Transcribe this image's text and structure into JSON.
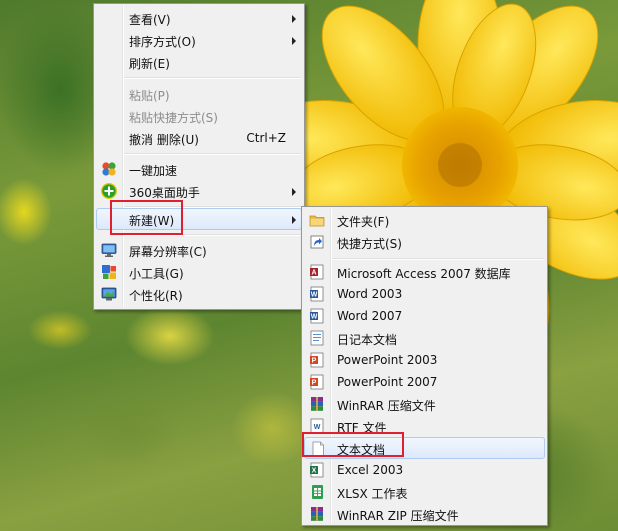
{
  "context_menu": {
    "items": [
      {
        "label": "查看(V)",
        "has_submenu": true,
        "enabled": true
      },
      {
        "label": "排序方式(O)",
        "has_submenu": true,
        "enabled": true
      },
      {
        "label": "刷新(E)",
        "has_submenu": false,
        "enabled": true
      },
      {
        "label": "粘贴(P)",
        "has_submenu": false,
        "enabled": false
      },
      {
        "label": "粘贴快捷方式(S)",
        "has_submenu": false,
        "enabled": false
      },
      {
        "label": "撤消 删除(U)",
        "shortcut": "Ctrl+Z",
        "has_submenu": false,
        "enabled": true
      },
      {
        "label": "一键加速",
        "icon": "speedup-icon",
        "has_submenu": false,
        "enabled": true
      },
      {
        "label": "360桌面助手",
        "icon": "360-icon",
        "has_submenu": true,
        "enabled": true
      },
      {
        "label": "新建(W)",
        "has_submenu": true,
        "enabled": true,
        "highlighted": true
      },
      {
        "label": "屏幕分辨率(C)",
        "icon": "monitor-icon",
        "has_submenu": false,
        "enabled": true
      },
      {
        "label": "小工具(G)",
        "icon": "gadgets-icon",
        "has_submenu": false,
        "enabled": true
      },
      {
        "label": "个性化(R)",
        "icon": "personalize-icon",
        "has_submenu": false,
        "enabled": true
      }
    ]
  },
  "new_submenu": {
    "items": [
      {
        "label": "文件夹(F)",
        "icon": "folder-icon"
      },
      {
        "label": "快捷方式(S)",
        "icon": "shortcut-icon"
      },
      {
        "label": "Microsoft Access 2007 数据库",
        "icon": "access-icon"
      },
      {
        "label": "Word 2003",
        "icon": "word-icon"
      },
      {
        "label": "Word 2007",
        "icon": "word-icon"
      },
      {
        "label": "日记本文档",
        "icon": "journal-icon"
      },
      {
        "label": "PowerPoint 2003",
        "icon": "powerpoint-icon"
      },
      {
        "label": "PowerPoint 2007",
        "icon": "powerpoint-icon"
      },
      {
        "label": "WinRAR 压缩文件",
        "icon": "winrar-icon"
      },
      {
        "label": "RTF 文件",
        "icon": "rtf-icon"
      },
      {
        "label": "文本文档",
        "icon": "text-document-icon",
        "highlighted": true
      },
      {
        "label": "Excel 2003",
        "icon": "excel-icon"
      },
      {
        "label": "XLSX 工作表",
        "icon": "xlsx-icon"
      },
      {
        "label": "WinRAR ZIP 压缩文件",
        "icon": "winrar-zip-icon"
      }
    ]
  },
  "colors": {
    "menu_bg": "#f0f0f0",
    "highlight_border": "#aecbf1",
    "annotation": "#e0202e",
    "disabled_text": "#8d8d8d"
  }
}
